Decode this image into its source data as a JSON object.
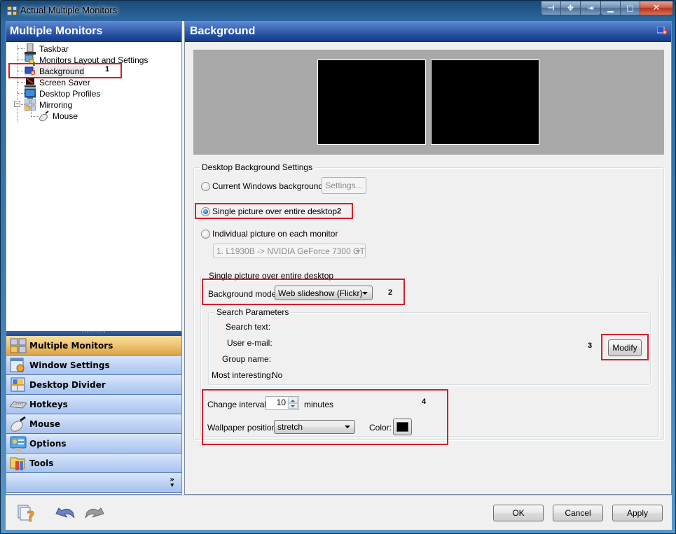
{
  "window": {
    "title": "Actual Multiple Monitors",
    "caption_buttons": [
      {
        "name": "pin-icon",
        "glyph": "⊣"
      },
      {
        "name": "move-icon",
        "glyph": "✥"
      },
      {
        "name": "move-to-monitor-icon",
        "glyph": "⇥"
      },
      {
        "name": "minimize-icon",
        "glyph": "▁"
      },
      {
        "name": "maximize-icon",
        "glyph": "□"
      },
      {
        "name": "close-icon",
        "glyph": "✕"
      }
    ]
  },
  "left_panel": {
    "header": "Multiple Monitors",
    "tree": [
      {
        "label": "Taskbar",
        "icon": "taskbar-icon"
      },
      {
        "label": "Monitors Layout and Settings",
        "icon": "monitors-layout-icon"
      },
      {
        "label": "Background",
        "icon": "background-icon",
        "selected": true
      },
      {
        "label": "Screen Saver",
        "icon": "screen-saver-icon"
      },
      {
        "label": "Desktop Profiles",
        "icon": "desktop-profiles-icon"
      },
      {
        "label": "Mirroring",
        "icon": "mirroring-icon",
        "expanded": true,
        "children": [
          {
            "label": "Mouse",
            "icon": "mouse-icon"
          }
        ]
      }
    ],
    "splitter_glyph": "··········",
    "nav": [
      {
        "label": "Multiple Monitors",
        "icon": "multiple-monitors-icon",
        "active": true
      },
      {
        "label": "Window Settings",
        "icon": "window-settings-icon"
      },
      {
        "label": "Desktop Divider",
        "icon": "desktop-divider-icon"
      },
      {
        "label": "Hotkeys",
        "icon": "keyboard-icon"
      },
      {
        "label": "Mouse",
        "icon": "mouse-icon"
      },
      {
        "label": "Options",
        "icon": "options-icon"
      },
      {
        "label": "Tools",
        "icon": "tools-icon"
      }
    ],
    "more_glyph": "»"
  },
  "right_panel": {
    "header": "Background",
    "monitor_preview": {
      "monitors": 2,
      "background_color": "#a9a9a9",
      "monitor_color": "#000000"
    },
    "desktop_background_settings": {
      "legend": "Desktop Background Settings",
      "options": [
        {
          "label": "Current Windows background",
          "checked": false
        },
        {
          "label": "Single picture over entire desktop",
          "checked": true
        },
        {
          "label": "Individual picture on each monitor",
          "checked": false
        }
      ],
      "settings_button": "Settings...",
      "monitor_select": "1. L1930B -> NVIDIA GeForce 7300 GT"
    },
    "single_picture": {
      "legend": "Single picture over entire desktop",
      "background_mode_label": "Background mode:",
      "background_mode_value": "Web slideshow (Flickr)",
      "search_parameters": {
        "legend": "Search Parameters",
        "search_text_label": "Search text:",
        "search_text_value": "",
        "user_email_label": "User e-mail:",
        "user_email_value": "",
        "group_name_label": "Group name:",
        "group_name_value": "",
        "most_interesting_label": "Most interesting:",
        "most_interesting_value": "No"
      },
      "modify_button": "Modify",
      "change_interval_label": "Change interval:",
      "change_interval_value": "10",
      "change_interval_unit": "minutes",
      "wallpaper_position_label": "Wallpaper position:",
      "wallpaper_position_value": "stretch",
      "color_label": "Color:",
      "color_value": "#000000"
    }
  },
  "annotations": {
    "n1": "1",
    "n2a": "2",
    "n2b": "2",
    "n3": "3",
    "n4": "4",
    "highlight_color": "#d21f2b"
  },
  "footer": {
    "help_icon": "help-icon",
    "undo_icon": "undo-icon",
    "redo_icon": "redo-icon",
    "ok": "OK",
    "cancel": "Cancel",
    "apply": "Apply"
  }
}
